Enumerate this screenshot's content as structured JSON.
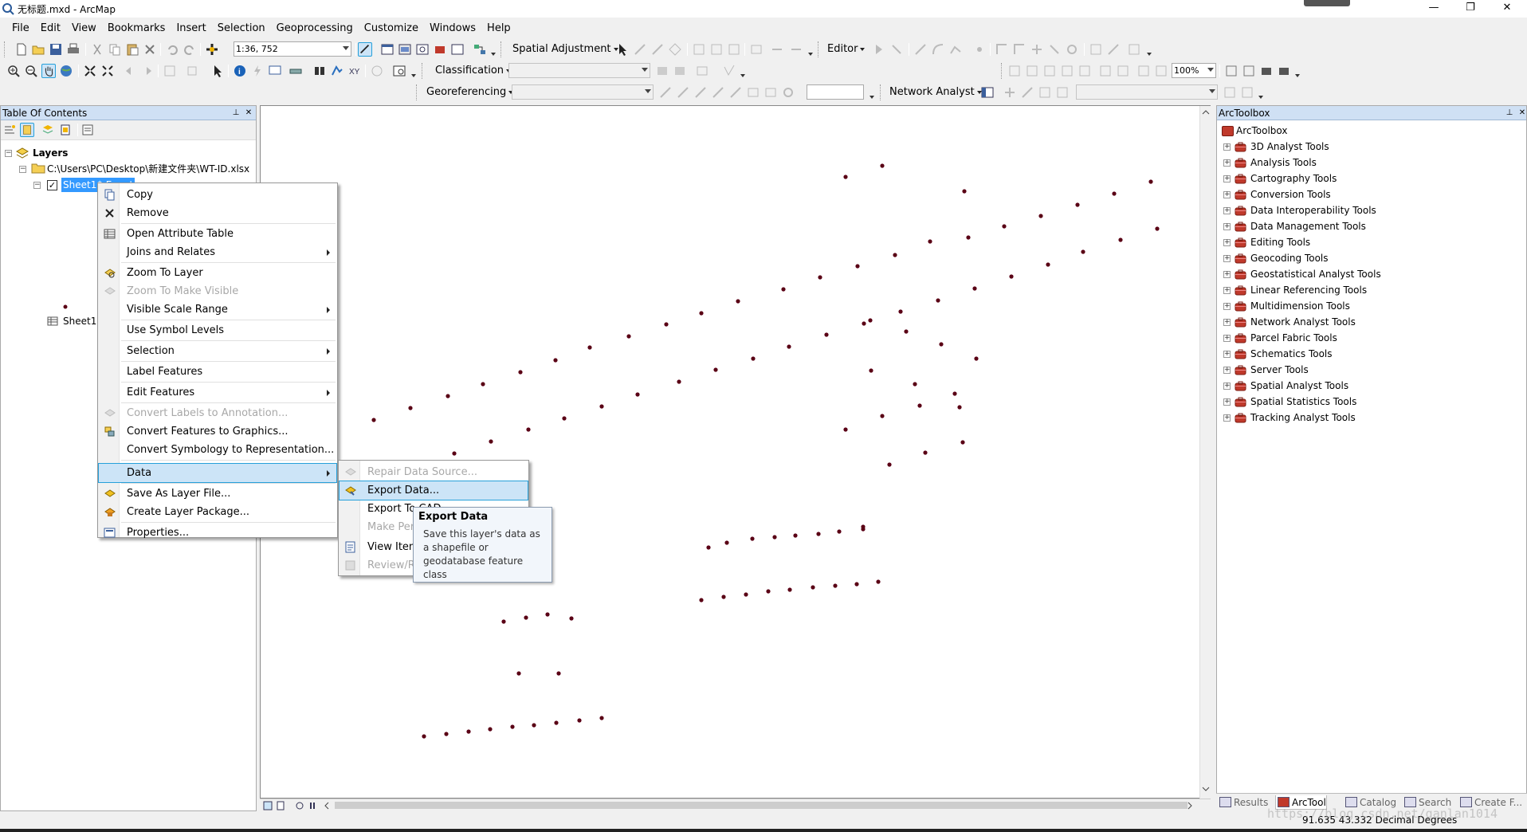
{
  "window": {
    "title": "无标题.mxd - ArcMap",
    "minimize": "—",
    "restore": "❐",
    "close": "✕"
  },
  "menubar": [
    "File",
    "Edit",
    "View",
    "Bookmarks",
    "Insert",
    "Selection",
    "Geoprocessing",
    "Customize",
    "Windows",
    "Help"
  ],
  "toolbars": {
    "scale": "1:36, 752",
    "spatial_adjustment": "Spatial Adjustment",
    "editor": "Editor",
    "classification": "Classification",
    "zoom_percent": "100%",
    "georeferencing": "Georeferencing",
    "network_analyst": "Network Analyst"
  },
  "toc": {
    "title": "Table Of Contents",
    "pin": "📌",
    "close": "✕",
    "layers_label": "Layers",
    "source_path": "C:\\Users\\PC\\Desktop\\新建文件夹\\WT-ID.xlsx",
    "layer_name": "Sheet1$ Event",
    "table_name": "Sheet1$"
  },
  "context_menu": {
    "items": [
      {
        "label": "Copy",
        "icon": "copy-icon",
        "enabled": true,
        "submenu": false
      },
      {
        "label": "Remove",
        "icon": "remove-icon",
        "enabled": true,
        "submenu": false
      },
      {
        "label": "Open Attribute Table",
        "icon": "table-icon",
        "enabled": true,
        "submenu": false
      },
      {
        "label": "Joins and Relates",
        "icon": "",
        "enabled": true,
        "submenu": true
      },
      {
        "label": "Zoom To Layer",
        "icon": "zoom-layer-icon",
        "enabled": true,
        "submenu": false
      },
      {
        "label": "Zoom To Make Visible",
        "icon": "zoom-visible-icon",
        "enabled": false,
        "submenu": false
      },
      {
        "label": "Visible Scale Range",
        "icon": "",
        "enabled": true,
        "submenu": true
      },
      {
        "label": "Use Symbol Levels",
        "icon": "",
        "enabled": true,
        "submenu": false
      },
      {
        "label": "Selection",
        "icon": "",
        "enabled": true,
        "submenu": true
      },
      {
        "label": "Label Features",
        "icon": "",
        "enabled": true,
        "submenu": false
      },
      {
        "label": "Edit Features",
        "icon": "",
        "enabled": true,
        "submenu": true
      },
      {
        "label": "Convert Labels to Annotation...",
        "icon": "annotation-icon",
        "enabled": false,
        "submenu": false
      },
      {
        "label": "Convert Features to Graphics...",
        "icon": "graphics-icon",
        "enabled": true,
        "submenu": false
      },
      {
        "label": "Convert Symbology to Representation...",
        "icon": "",
        "enabled": true,
        "submenu": false
      },
      {
        "label": "Data",
        "icon": "",
        "enabled": true,
        "submenu": true,
        "highlighted": true
      },
      {
        "label": "Save As Layer File...",
        "icon": "layer-file-icon",
        "enabled": true,
        "submenu": false
      },
      {
        "label": "Create Layer Package...",
        "icon": "layer-package-icon",
        "enabled": true,
        "submenu": false
      },
      {
        "label": "Properties...",
        "icon": "properties-icon",
        "enabled": true,
        "submenu": false
      }
    ]
  },
  "data_submenu": {
    "items": [
      {
        "label": "Repair Data Source...",
        "enabled": false
      },
      {
        "label": "Export Data...",
        "enabled": true,
        "highlighted": true
      },
      {
        "label": "Export To CAD",
        "enabled": true
      },
      {
        "label": "Make Permanent",
        "enabled": false
      },
      {
        "label": "View Item Description",
        "enabled": true
      },
      {
        "label": "Review/Rematch Addresses",
        "enabled": false
      }
    ]
  },
  "tooltip": {
    "title": "Export Data",
    "body": "Save this layer's data as a shapefile or geodatabase feature class"
  },
  "arctoolbox": {
    "title": "ArcToolbox",
    "root": "ArcToolbox",
    "tools": [
      "3D Analyst Tools",
      "Analysis Tools",
      "Cartography Tools",
      "Conversion Tools",
      "Data Interoperability Tools",
      "Data Management Tools",
      "Editing Tools",
      "Geocoding Tools",
      "Geostatistical Analyst Tools",
      "Linear Referencing Tools",
      "Multidimension Tools",
      "Network Analyst Tools",
      "Parcel Fabric Tools",
      "Schematics Tools",
      "Server Tools",
      "Spatial Analyst Tools",
      "Spatial Statistics Tools",
      "Tracking Analyst Tools"
    ],
    "tabs": [
      "Results",
      "ArcTool",
      "Catalog",
      "Search",
      "Create F..."
    ]
  },
  "status": {
    "coords": "91.635  43.332 Decimal Degrees",
    "watermark": "https://blog.csdn.net/ganlan1014"
  },
  "colors": {
    "point": "#5a0015",
    "selection": "#3399ff",
    "panel_header": "#cfe0f4",
    "menu_highlight": "#cce4f7"
  }
}
